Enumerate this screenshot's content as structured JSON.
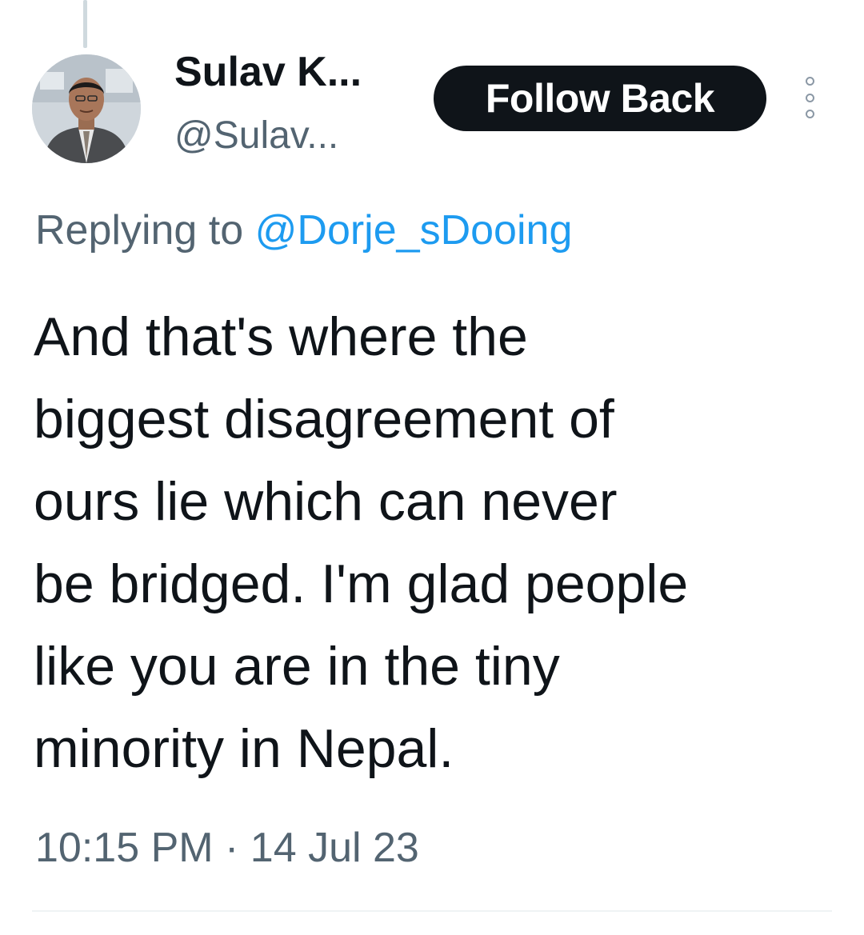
{
  "tweet": {
    "author": {
      "display_name": "Sulav K...",
      "handle": "@Sulav...",
      "avatar_icon": "profile-photo"
    },
    "follow_label": "Follow Back",
    "more_icon": "more-vertical-icon",
    "replying_prefix": "Replying to",
    "replying_to": "@Dorje_sDooing",
    "text": "And that's where the\nbiggest disagreement of\nours lie which can never\nbe bridged. I'm glad people\nlike you are in the tiny\nminority in Nepal.",
    "timestamp": "10:15 PM · 14 Jul 23"
  },
  "colors": {
    "text_primary": "#0f1419",
    "text_secondary": "#536471",
    "link": "#1d9bf0",
    "button_bg": "#0f1419",
    "divider": "#eff3f4"
  }
}
